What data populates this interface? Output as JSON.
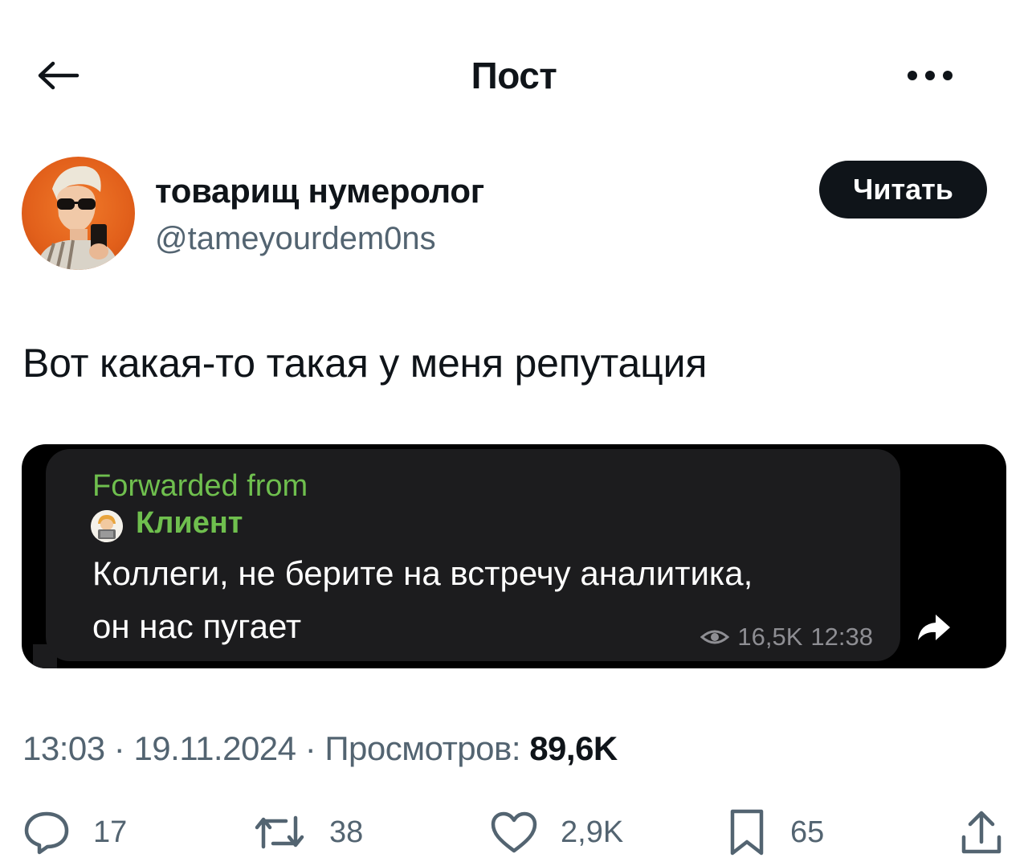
{
  "header": {
    "title": "Пост"
  },
  "author": {
    "name": "товарищ нумеролог",
    "handle": "@tameyourdem0ns",
    "follow_label": "Читать"
  },
  "post": {
    "text": "Вот какая-то такая у меня репутация"
  },
  "media": {
    "forwarded_label": "Forwarded from",
    "forwarded_name": "Клиент",
    "message_lines": [
      "Коллеги, не берите на встречу аналитика,",
      "он нас пугает"
    ],
    "views": "16,5K",
    "time": "12:38"
  },
  "meta": {
    "time": "13:03",
    "date": "19.11.2024",
    "views_label": "Просмотров:",
    "views_count": "89,6K"
  },
  "actions": {
    "replies": "17",
    "reposts": "38",
    "likes": "2,9K",
    "bookmarks": "65"
  },
  "colors": {
    "text": "#0f1419",
    "secondary": "#536471",
    "telegram_green": "#6fbf4e",
    "bubble": "#1c1c1e"
  },
  "icons": {
    "back": "arrow-left-icon",
    "more": "more-horizontal-icon",
    "reply": "comment-icon",
    "repost": "repost-icon",
    "like": "heart-icon",
    "bookmark": "bookmark-icon",
    "share": "share-icon"
  }
}
